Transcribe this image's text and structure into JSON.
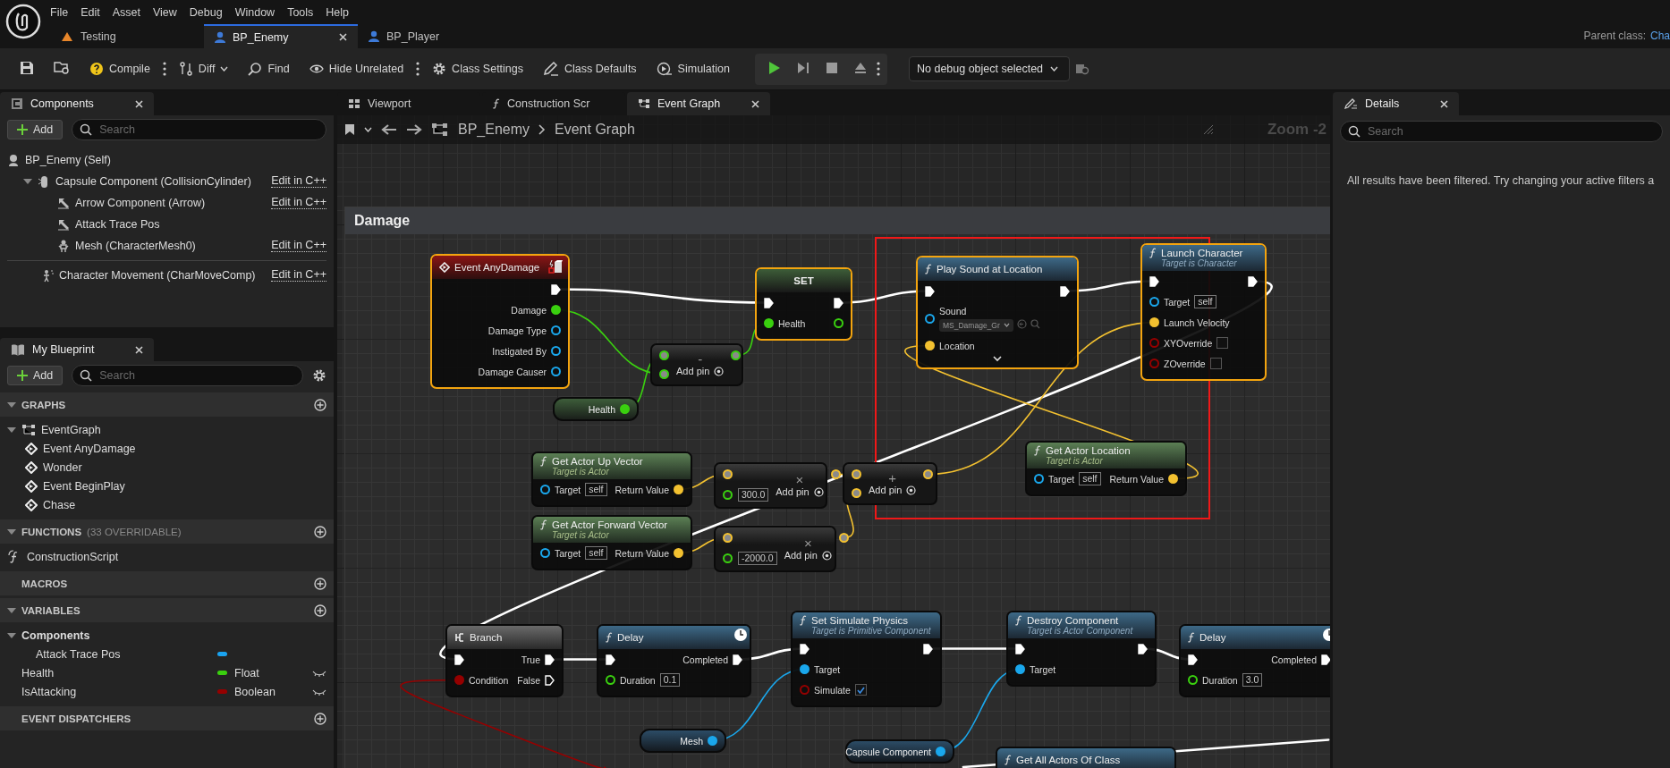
{
  "menu": [
    "File",
    "Edit",
    "Asset",
    "View",
    "Debug",
    "Window",
    "Tools",
    "Help"
  ],
  "documents": [
    {
      "label": "Testing",
      "kind": "level",
      "selected": false
    },
    {
      "label": "BP_Enemy",
      "kind": "blueprint",
      "selected": true
    },
    {
      "label": "BP_Player",
      "kind": "blueprint",
      "selected": false
    }
  ],
  "parent_class": {
    "label": "Parent class:",
    "value": "Cha"
  },
  "toolbar": [
    {
      "kind": "compile",
      "label": "Compile"
    },
    {
      "kind": "diff",
      "label": "Diff"
    },
    {
      "kind": "find",
      "label": "Find"
    },
    {
      "kind": "hide",
      "label": "Hide Unrelated"
    },
    {
      "kind": "settings",
      "label": "Class Settings"
    },
    {
      "kind": "defaults",
      "label": "Class Defaults"
    },
    {
      "kind": "simulation",
      "label": "Simulation"
    }
  ],
  "debug_filter": {
    "value": "No debug object selected"
  },
  "components": {
    "tab": "Components",
    "add": "Add",
    "search": {
      "placeholder": "Search"
    },
    "tree": [
      {
        "label": "BP_Enemy (Self)",
        "kind": "actor",
        "children": [
          {
            "label": "Capsule Component (CollisionCylinder)",
            "kind": "capsule",
            "link": "Edit in C++",
            "expanded": true,
            "children": [
              {
                "label": "Arrow Component (Arrow)",
                "kind": "arrow",
                "link": "Edit in C++"
              },
              {
                "label": "Attack Trace Pos",
                "kind": "arrow"
              },
              {
                "label": "Mesh (CharacterMesh0)",
                "kind": "mesh",
                "link": "Edit in C++"
              }
            ]
          },
          {
            "label": "Character Movement (CharMoveComp)",
            "kind": "movement",
            "link": "Edit in C++"
          }
        ]
      }
    ]
  },
  "my_blueprint": {
    "tab": "My Blueprint",
    "add": "Add",
    "search": {
      "placeholder": "Search"
    },
    "sections": [
      {
        "title": "GRAPHS",
        "expanded": true,
        "items": [
          {
            "kind": "graph",
            "label": "EventGraph",
            "expanded": true,
            "children": [
              {
                "kind": "event",
                "label": "Event AnyDamage"
              },
              {
                "kind": "event",
                "label": "Wonder"
              },
              {
                "kind": "event",
                "label": "Event BeginPlay"
              },
              {
                "kind": "event",
                "label": "Chase"
              }
            ]
          }
        ]
      },
      {
        "title": "FUNCTIONS",
        "note": "(33 OVERRIDABLE)",
        "expanded": true,
        "items": [
          {
            "kind": "function",
            "label": "ConstructionScript"
          }
        ]
      },
      {
        "title": "MACROS"
      },
      {
        "title": "VARIABLES",
        "expanded": true,
        "items": [
          {
            "kind": "category",
            "label": "Components",
            "expanded": true,
            "children": [
              {
                "kind": "variable",
                "label": "Attack Trace Pos",
                "color": "#1aa3f0"
              }
            ]
          },
          {
            "kind": "variable",
            "label": "Health",
            "color": "#3ad00f",
            "type": "Float"
          },
          {
            "kind": "variable",
            "label": "IsAttacking",
            "color": "#960000",
            "type": "Boolean"
          }
        ]
      },
      {
        "title": "EVENT DISPATCHERS"
      }
    ]
  },
  "graph_tabs": [
    {
      "label": "Viewport",
      "kind": "viewport",
      "selected": false
    },
    {
      "label": "Construction Scr",
      "kind": "function",
      "selected": false
    },
    {
      "label": "Event Graph",
      "kind": "graph",
      "selected": true
    }
  ],
  "breadcrumb": [
    "BP_Enemy",
    "Event Graph"
  ],
  "zoom": "Zoom -2",
  "graph": {
    "comment": {
      "title": "Damage"
    },
    "nodes": [
      {
        "kind": "event",
        "title": "Event AnyDamage",
        "selected": true,
        "outputs": [
          {
            "kind": "exec",
            "connected": true
          },
          {
            "kind": "float",
            "label": "Damage",
            "connected": true
          },
          {
            "kind": "object",
            "label": "Damage Type",
            "connected": false
          },
          {
            "kind": "object",
            "label": "Instigated By",
            "connected": false
          },
          {
            "kind": "object",
            "label": "Damage Causer",
            "connected": false
          }
        ]
      },
      {
        "kind": "set",
        "title": "SET",
        "selected": true,
        "inputs": [
          {
            "kind": "exec",
            "connected": true
          },
          {
            "kind": "float",
            "label": "Health",
            "connected": true
          }
        ],
        "outputs": [
          {
            "kind": "exec",
            "connected": true
          },
          {
            "kind": "float",
            "connected": false
          }
        ]
      },
      {
        "kind": "math",
        "operator": "-",
        "add_pin": "Add pin",
        "selected": false,
        "inputs": [
          {
            "kind": "float",
            "connected": true
          },
          {
            "kind": "float",
            "connected": true
          }
        ],
        "outputs": [
          {
            "kind": "float",
            "connected": true
          }
        ]
      },
      {
        "kind": "get",
        "title": "Health",
        "selected": false,
        "outputs": [
          {
            "kind": "float",
            "connected": true
          }
        ]
      },
      {
        "kind": "pure",
        "title": "Get Actor Up Vector",
        "subtitle": "Target is Actor",
        "selected": false,
        "inputs": [
          {
            "kind": "object",
            "label": "Target",
            "default": "self",
            "connected": false
          }
        ],
        "outputs": [
          {
            "kind": "vector",
            "label": "Return Value",
            "connected": true
          }
        ]
      },
      {
        "kind": "math",
        "operator": "×",
        "add_pin": "Add pin",
        "selected": false,
        "inputs": [
          {
            "kind": "vector",
            "connected": true
          },
          {
            "kind": "float",
            "default": "300.0",
            "connected": false
          }
        ],
        "outputs": [
          {
            "kind": "vector",
            "connected": true
          }
        ]
      },
      {
        "kind": "pure",
        "title": "Get Actor Forward Vector",
        "subtitle": "Target is Actor",
        "selected": false,
        "inputs": [
          {
            "kind": "object",
            "label": "Target",
            "default": "self",
            "connected": false
          }
        ],
        "outputs": [
          {
            "kind": "vector",
            "label": "Return Value",
            "connected": true
          }
        ]
      },
      {
        "kind": "math",
        "operator": "×",
        "add_pin": "Add pin",
        "selected": false,
        "inputs": [
          {
            "kind": "vector",
            "connected": true
          },
          {
            "kind": "float",
            "default": "-2000.0",
            "connected": false
          }
        ],
        "outputs": [
          {
            "kind": "vector",
            "connected": true
          }
        ]
      },
      {
        "kind": "math",
        "operator": "+",
        "add_pin": "Add pin",
        "selected": false,
        "inputs": [
          {
            "kind": "vector",
            "connected": true
          },
          {
            "kind": "vector",
            "connected": true
          }
        ],
        "outputs": [
          {
            "kind": "vector",
            "connected": true
          }
        ]
      },
      {
        "kind": "function",
        "title": "Play Sound at Location",
        "selected": true,
        "advanced": true,
        "inputs": [
          {
            "kind": "exec",
            "connected": true
          },
          {
            "kind": "object",
            "label": "Sound",
            "asset": "MS_Damage_Gr",
            "connected": false
          },
          {
            "kind": "vector",
            "label": "Location",
            "connected": true
          }
        ],
        "outputs": [
          {
            "kind": "exec",
            "connected": true
          }
        ]
      },
      {
        "kind": "function",
        "title": "Launch Character",
        "subtitle": "Target is Character",
        "selected": true,
        "inputs": [
          {
            "kind": "exec",
            "connected": true
          },
          {
            "kind": "object",
            "label": "Target",
            "default": "self",
            "connected": false
          },
          {
            "kind": "vector",
            "label": "Launch Velocity",
            "connected": true
          },
          {
            "kind": "bool",
            "label": "XYOverride",
            "checked": false,
            "connected": false
          },
          {
            "kind": "bool",
            "label": "ZOverride",
            "checked": false,
            "connected": false
          }
        ],
        "outputs": [
          {
            "kind": "exec",
            "connected": true
          }
        ]
      },
      {
        "kind": "pure",
        "title": "Get Actor Location",
        "subtitle": "Target is Actor",
        "selected": false,
        "inputs": [
          {
            "kind": "object",
            "label": "Target",
            "default": "self",
            "connected": false
          }
        ],
        "outputs": [
          {
            "kind": "vector",
            "label": "Return Value",
            "connected": true
          }
        ]
      },
      {
        "kind": "branch",
        "title": "Branch",
        "selected": false,
        "inputs": [
          {
            "kind": "exec",
            "connected": true
          },
          {
            "kind": "bool",
            "label": "Condition",
            "connected": true
          }
        ],
        "outputs": [
          {
            "kind": "exec",
            "label": "True",
            "connected": true
          },
          {
            "kind": "exec",
            "label": "False",
            "connected": false
          }
        ]
      },
      {
        "kind": "function",
        "title": "Delay",
        "latent": true,
        "selected": false,
        "inputs": [
          {
            "kind": "exec",
            "connected": true
          },
          {
            "kind": "float",
            "label": "Duration",
            "default": "0.1",
            "connected": false
          }
        ],
        "outputs": [
          {
            "kind": "exec",
            "label": "Completed",
            "connected": true
          }
        ]
      },
      {
        "kind": "function",
        "title": "Set Simulate Physics",
        "subtitle": "Target is Primitive Component",
        "selected": false,
        "inputs": [
          {
            "kind": "exec",
            "connected": true
          },
          {
            "kind": "object",
            "label": "Target",
            "connected": true
          },
          {
            "kind": "bool",
            "label": "Simulate",
            "checked": true,
            "connected": false
          }
        ],
        "outputs": [
          {
            "kind": "exec",
            "connected": true
          }
        ]
      },
      {
        "kind": "function",
        "title": "Destroy Component",
        "subtitle": "Target is Actor Component",
        "selected": false,
        "inputs": [
          {
            "kind": "exec",
            "connected": true
          },
          {
            "kind": "object",
            "label": "Target",
            "connected": true
          }
        ],
        "outputs": [
          {
            "kind": "exec",
            "connected": true
          }
        ]
      },
      {
        "kind": "function",
        "title": "Delay",
        "latent": true,
        "selected": false,
        "inputs": [
          {
            "kind": "exec",
            "connected": true
          },
          {
            "kind": "float",
            "label": "Duration",
            "default": "3.0",
            "connected": false
          }
        ],
        "outputs": [
          {
            "kind": "exec",
            "label": "Completed",
            "connected": true
          }
        ]
      },
      {
        "kind": "get",
        "title": "Mesh",
        "selected": false,
        "outputs": [
          {
            "kind": "object",
            "connected": true
          }
        ]
      },
      {
        "kind": "get",
        "title": "Capsule Component",
        "selected": false,
        "outputs": [
          {
            "kind": "object",
            "connected": true
          }
        ]
      },
      {
        "kind": "function",
        "title": "Get All Actors Of Class",
        "selected": false
      }
    ]
  },
  "details": {
    "tab": "Details",
    "search": {
      "placeholder": "Search"
    },
    "message": "All results have been filtered. Try changing your active filters a"
  }
}
